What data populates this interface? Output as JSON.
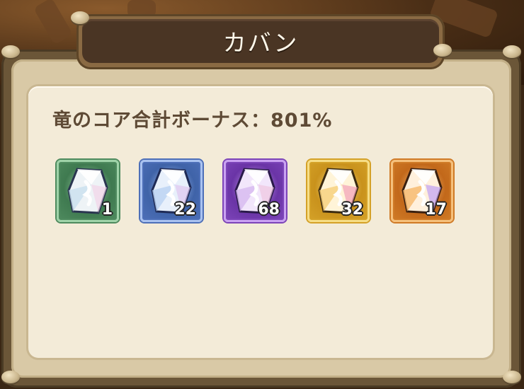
{
  "window": {
    "title": "カバン"
  },
  "bonus": {
    "text": "竜のコア合計ボーナス：801%",
    "value_percent": 801
  },
  "cores": [
    {
      "rarity": "green",
      "count": "1",
      "frame_color": "#4e8a5e",
      "border_color": "#9fd3a9",
      "bg_color": "#3f7a50"
    },
    {
      "rarity": "blue",
      "count": "22",
      "frame_color": "#4d6fb8",
      "border_color": "#a9c2f0",
      "bg_color": "#3f63a8"
    },
    {
      "rarity": "purple",
      "count": "68",
      "frame_color": "#7c44b8",
      "border_color": "#caa2f2",
      "bg_color": "#6a34a6"
    },
    {
      "rarity": "gold",
      "count": "32",
      "frame_color": "#d4a128",
      "border_color": "#f6dd86",
      "bg_color": "#c9921c"
    },
    {
      "rarity": "orange",
      "count": "17",
      "frame_color": "#cf7a26",
      "border_color": "#f5c07c",
      "bg_color": "#c2681a"
    }
  ],
  "colors": {
    "panel_bg": "#f3ebd8",
    "text_brown": "#5e4a35",
    "title_bg": "#4a3524"
  }
}
